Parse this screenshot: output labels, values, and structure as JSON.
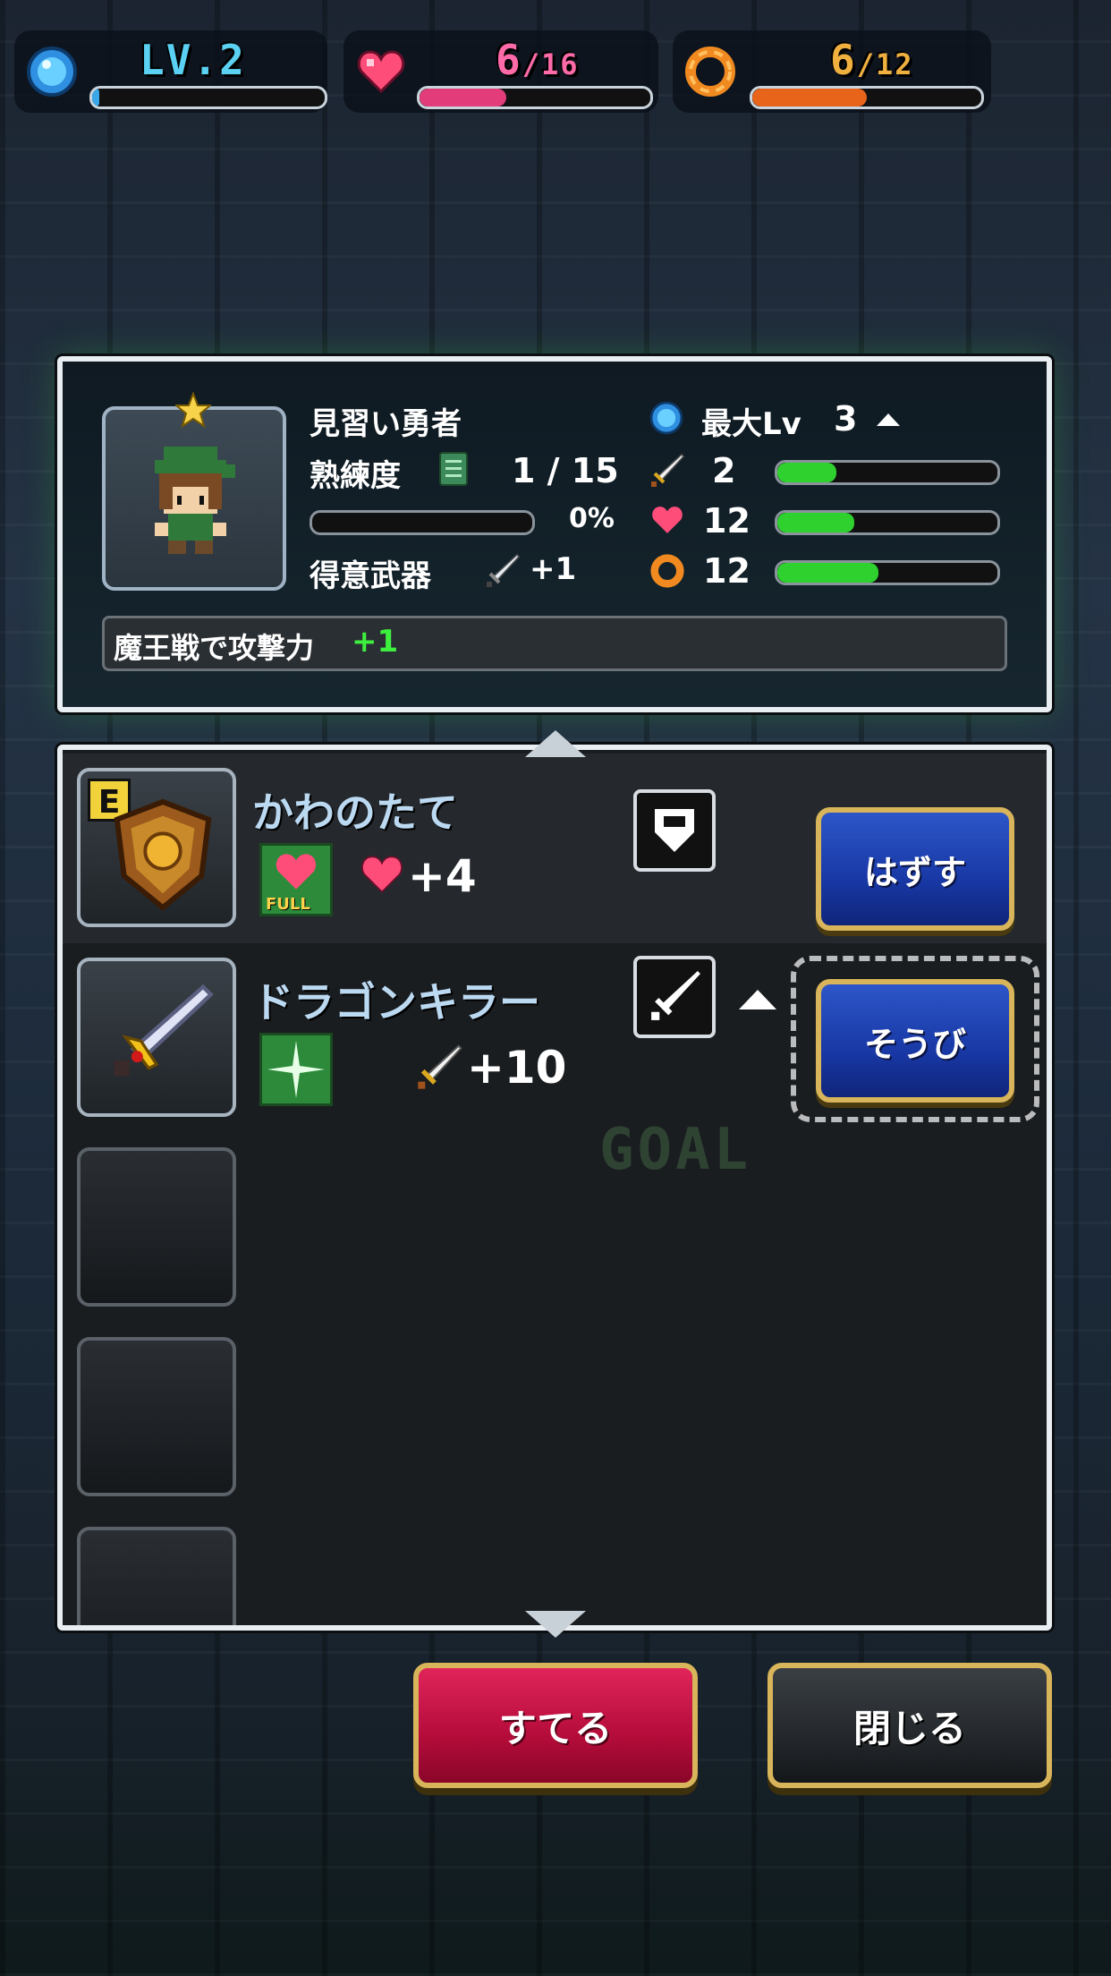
{
  "hud": {
    "level": {
      "icon": "blue-gem-icon",
      "text": "LV.2",
      "progress": 0.03,
      "color": "#5ad1f2"
    },
    "hp": {
      "icon": "heart-icon",
      "current": "6",
      "max": "/16",
      "progress": 0.375,
      "color": "#ff6aa8"
    },
    "stamina": {
      "icon": "orange-ring-icon",
      "current": "6",
      "max": "/12",
      "progress": 0.5,
      "color": "#f0b040"
    }
  },
  "character": {
    "name": "見習い勇者",
    "mastery_label": "熟練度",
    "mastery_value": "1 / 15",
    "mastery_percent": "0%",
    "mastery_progress": 0,
    "favorite_weapon_label": "得意武器",
    "favorite_weapon_bonus": "+1",
    "max_lv_label": "最大Lv",
    "max_lv_value": "3",
    "stats": [
      {
        "icon": "sword-icon",
        "value": "2",
        "fill": 0.27
      },
      {
        "icon": "heart-icon",
        "value": "12",
        "fill": 0.35
      },
      {
        "icon": "orange-ring-icon",
        "value": "12",
        "fill": 0.46
      }
    ],
    "skill_text": "魔王戦で攻撃力",
    "skill_bonus": "+1"
  },
  "items": [
    {
      "name": "かわのたて",
      "equipped_badge": "E",
      "effect_label": "FULL",
      "bonus": "+4",
      "type_icon": "shield-icon",
      "button": "はずす"
    },
    {
      "name": "ドラゴンキラー",
      "bonus": "+10",
      "type_icon": "sword-icon",
      "button": "そうび"
    }
  ],
  "buttons": {
    "discard": "すてる",
    "close": "閉じる"
  },
  "background_goal_text": "GOAL",
  "colors": {
    "accent_gold": "#d8b45a",
    "bar_green": "#2fd12f",
    "button_blue": "#1838a5",
    "button_red": "#c0103a"
  }
}
